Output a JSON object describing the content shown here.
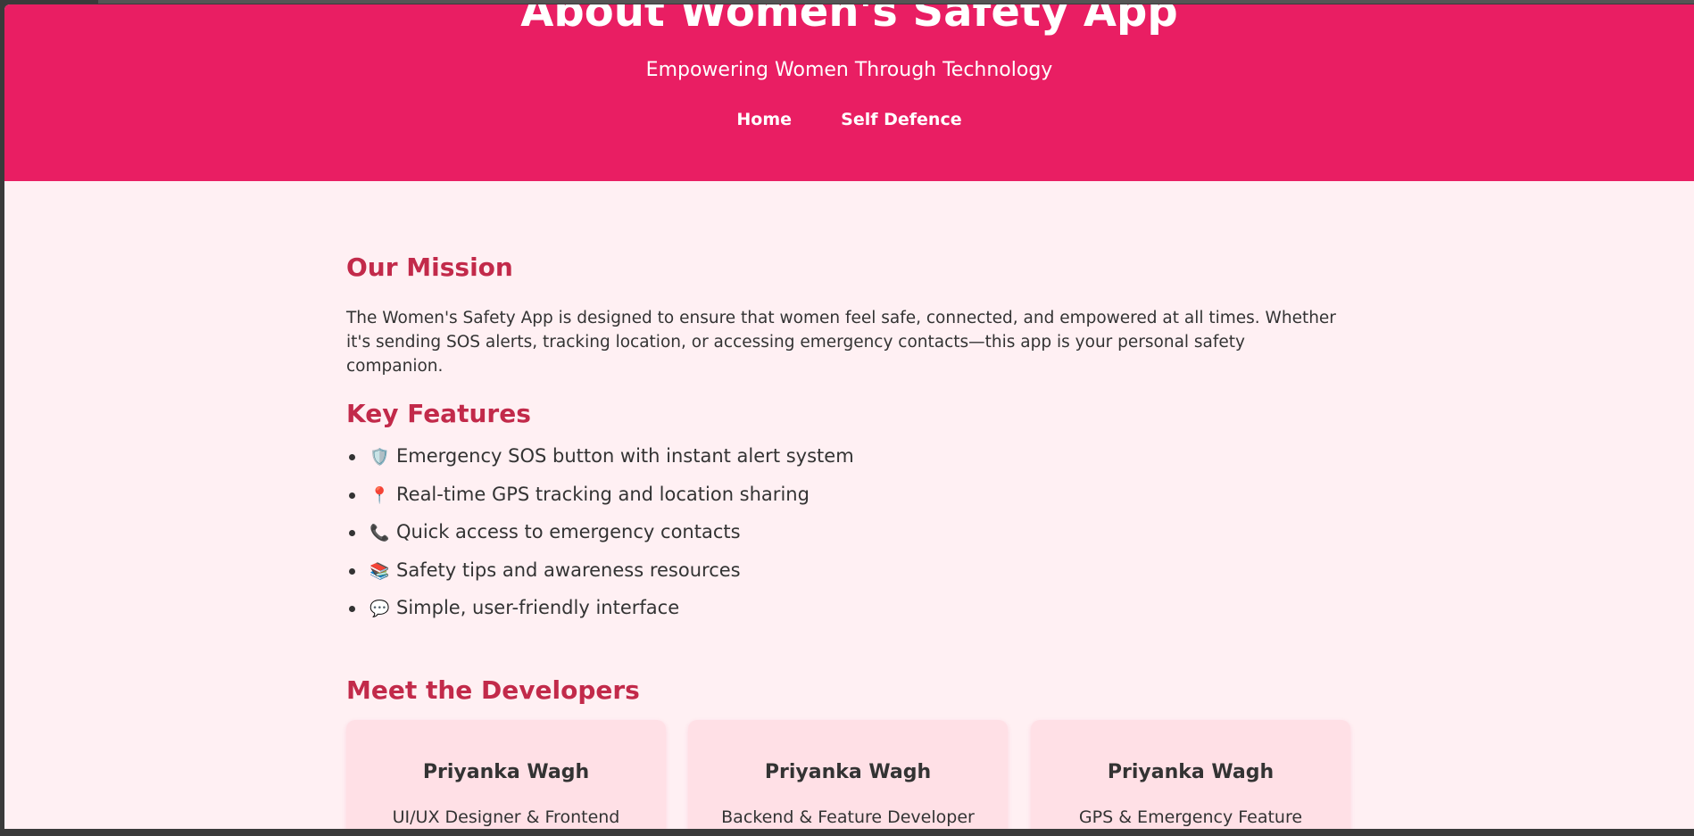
{
  "header": {
    "title": "About Women's Safety App",
    "tagline": "Empowering Women Through Technology",
    "nav": [
      {
        "label": "Home"
      },
      {
        "label": "Self Defence"
      }
    ]
  },
  "mission": {
    "title": "Our Mission",
    "text": "The Women's Safety App is designed to ensure that women feel safe, connected, and empowered at all times. Whether it's sending SOS alerts, tracking location, or accessing emergency contacts—this app is your personal safety companion."
  },
  "features": {
    "title": "Key Features",
    "items": [
      {
        "icon": "shield-icon",
        "glyph": "🛡️",
        "label": "Emergency SOS button with instant alert system"
      },
      {
        "icon": "pin-icon",
        "glyph": "📍",
        "label": "Real-time GPS tracking and location sharing"
      },
      {
        "icon": "phone-icon",
        "glyph": "📞",
        "label": "Quick access to emergency contacts"
      },
      {
        "icon": "books-icon",
        "glyph": "📚",
        "label": "Safety tips and awareness resources"
      },
      {
        "icon": "speech-bubble-icon",
        "glyph": "💬",
        "label": "Simple, user-friendly interface"
      }
    ]
  },
  "developers": {
    "title": "Meet the Developers",
    "cards": [
      {
        "name": "Priyanka Wagh",
        "role": "UI/UX Designer & Frontend"
      },
      {
        "name": "Priyanka Wagh",
        "role": "Backend & Feature Developer"
      },
      {
        "name": "Priyanka Wagh",
        "role": "GPS & Emergency Feature"
      }
    ]
  },
  "colors": {
    "header_bg": "#e91e63",
    "page_bg": "#fff0f3",
    "heading": "#c22a4a",
    "card_bg": "#ffe0e6"
  }
}
